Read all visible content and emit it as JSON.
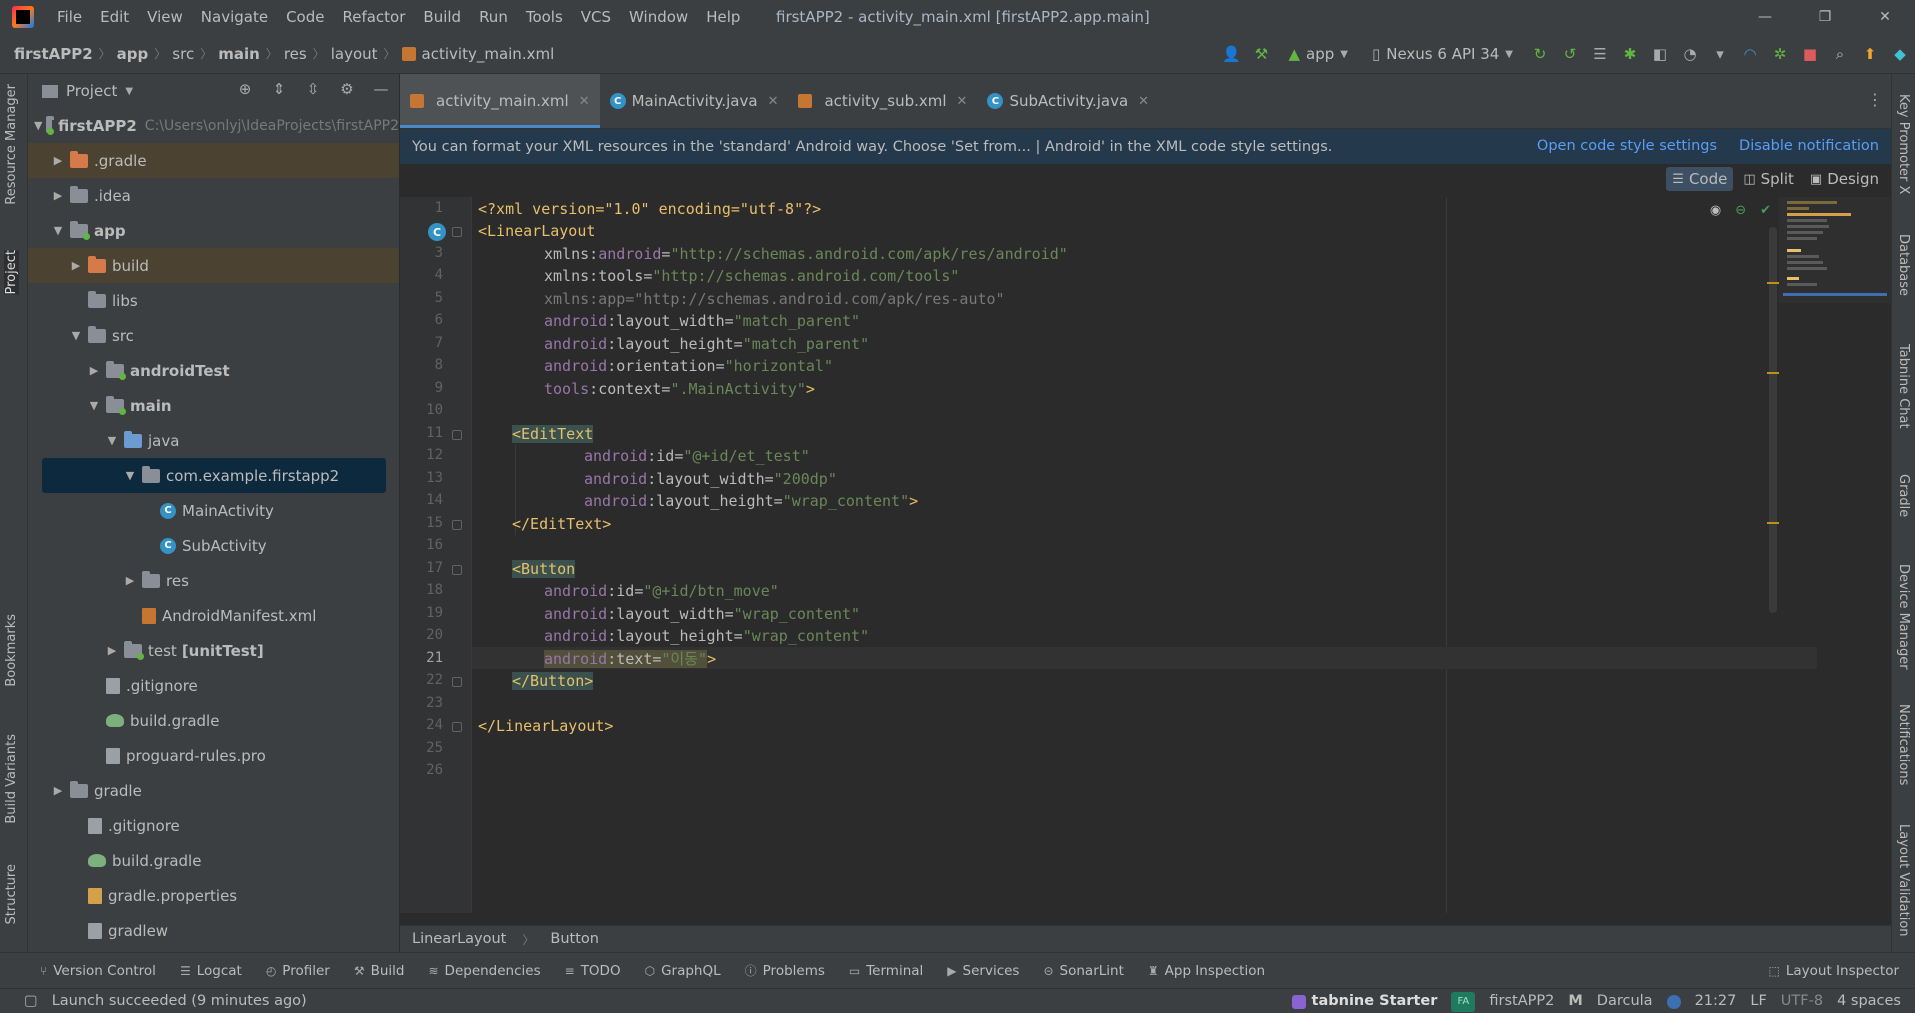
{
  "window": {
    "menu": [
      "File",
      "Edit",
      "View",
      "Navigate",
      "Code",
      "Refactor",
      "Build",
      "Run",
      "Tools",
      "VCS",
      "Window",
      "Help"
    ],
    "title": "firstAPP2 - activity_main.xml [firstAPP2.app.main]"
  },
  "navbar": {
    "crumbs": [
      "firstAPP2",
      "app",
      "src",
      "main",
      "res",
      "layout",
      "activity_main.xml"
    ],
    "run_config": "app",
    "device": "Nexus 6 API 34"
  },
  "left_stripe": {
    "resource_manager": "Resource Manager",
    "project": "Project",
    "bookmarks": "Bookmarks",
    "build_variants": "Build Variants",
    "structure": "Structure"
  },
  "right_stripe": {
    "key_promoter": "Key Promoter X",
    "database": "Database",
    "tabnine_chat": "Tabnine Chat",
    "gradle": "Gradle",
    "device_manager": "Device Manager",
    "notifications": "Notifications",
    "layout_validation": "Layout Validation"
  },
  "project_panel": {
    "title": "Project",
    "root_name": "firstAPP2",
    "root_path": "C:\\Users\\onlyj\\IdeaProjects\\firstAPP2",
    "items": [
      {
        "label": ".gradle"
      },
      {
        "label": ".idea"
      },
      {
        "label": "app"
      },
      {
        "label": "build"
      },
      {
        "label": "libs"
      },
      {
        "label": "src"
      },
      {
        "label": "androidTest"
      },
      {
        "label": "main"
      },
      {
        "label": "java"
      },
      {
        "label": "com.example.firstapp2"
      },
      {
        "label": "MainActivity"
      },
      {
        "label": "SubActivity"
      },
      {
        "label": "res"
      },
      {
        "label": "AndroidManifest.xml"
      },
      {
        "label": "test",
        "suffix": "[unitTest]"
      },
      {
        "label": ".gitignore"
      },
      {
        "label": "build.gradle"
      },
      {
        "label": "proguard-rules.pro"
      },
      {
        "label": "gradle"
      },
      {
        "label": ".gitignore"
      },
      {
        "label": "build.gradle"
      },
      {
        "label": "gradle.properties"
      },
      {
        "label": "gradlew"
      }
    ]
  },
  "tabs": [
    "activity_main.xml",
    "MainActivity.java",
    "activity_sub.xml",
    "SubActivity.java"
  ],
  "notification": {
    "text": "You can format your XML resources in the 'standard' Android way. Choose 'Set from... | Android' in the XML code style settings.",
    "link_open": "Open code style settings",
    "link_disable": "Disable notification"
  },
  "view_modes": {
    "code": "Code",
    "split": "Split",
    "design": "Design"
  },
  "code": {
    "line_numbers": [
      "1",
      "2",
      "3",
      "4",
      "5",
      "6",
      "7",
      "8",
      "9",
      "10",
      "11",
      "12",
      "13",
      "14",
      "15",
      "16",
      "17",
      "18",
      "19",
      "20",
      "21",
      "22",
      "23",
      "24",
      "25",
      "26"
    ],
    "l1": "<?xml version=\"1.0\" encoding=\"utf-8\"?>",
    "l2": "<LinearLayout",
    "l3_ns": "android",
    "l3_val": "\"http://schemas.android.com/apk/res/android\"",
    "l4_ns": "tools",
    "l4_val": "\"http://schemas.android.com/tools\"",
    "l5": "xmlns:app=\"http://schemas.android.com/apk/res-auto\"",
    "l6_attr": "layout_width",
    "l6_val": "\"match_parent\"",
    "l7_attr": "layout_height",
    "l7_val": "\"match_parent\"",
    "l8_attr": "orientation",
    "l8_val": "\"horizontal\"",
    "l9_attr": "context",
    "l9_val": "\".MainActivity\"",
    "l11_tag": "EditText",
    "l12_attr": "id",
    "l12_val": "\"@+id/et_test\"",
    "l13_attr": "layout_width",
    "l13_val": "\"200dp\"",
    "l14_attr": "layout_height",
    "l14_val": "\"wrap_content\"",
    "l15_tag": "</EditText>",
    "l17_tag": "Button",
    "l18_attr": "id",
    "l18_val": "\"@+id/btn_move\"",
    "l19_attr": "layout_width",
    "l19_val": "\"wrap_content\"",
    "l20_attr": "layout_height",
    "l20_val": "\"wrap_content\"",
    "l21_attr": "text",
    "l21_val": "\"이동\"",
    "l22_tag": "</Button>",
    "l24_tag": "</LinearLayout>"
  },
  "editor_breadcrumb": [
    "LinearLayout",
    "Button"
  ],
  "tool_windows": {
    "items": [
      "Version Control",
      "Logcat",
      "Profiler",
      "Build",
      "Dependencies",
      "TODO",
      "GraphQL",
      "Problems",
      "Terminal",
      "Services",
      "SonarLint",
      "App Inspection"
    ],
    "layout_inspector": "Layout Inspector"
  },
  "status": {
    "message": "Launch succeeded (9 minutes ago)",
    "tabnine": "tabnine Starter",
    "project_badge": "FA",
    "project": "firstAPP2",
    "theme": "Darcula",
    "position": "21:27",
    "line_sep": "LF",
    "encoding": "UTF-8",
    "indent": "4 spaces"
  },
  "colors": {
    "accent": "#4a88c7",
    "tag": "#e8bf6a",
    "namespace": "#9876aa",
    "string": "#6a8759",
    "link": "#589df6"
  }
}
